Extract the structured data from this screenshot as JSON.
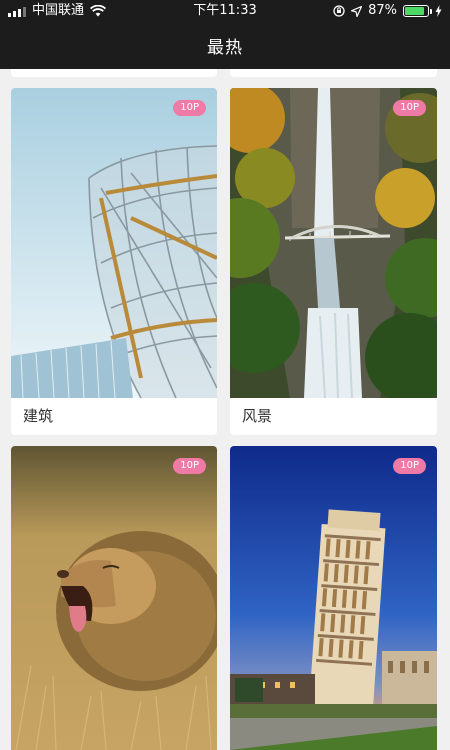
{
  "status_bar": {
    "carrier": "中国联通",
    "time": "下午11:33",
    "battery": "87%",
    "battery_level": 0.87
  },
  "header": {
    "title": "最热"
  },
  "cards": [
    {
      "label": "建筑",
      "badge": "10P",
      "image": "architecture-photo"
    },
    {
      "label": "风景",
      "badge": "10P",
      "image": "waterfall-photo"
    },
    {
      "label": "",
      "badge": "10P",
      "image": "lion-photo"
    },
    {
      "label": "",
      "badge": "10P",
      "image": "leaning-tower-photo"
    }
  ],
  "icons": {
    "signal": "signal-icon",
    "wifi": "wifi-icon",
    "lock_rotation": "rotation-lock-icon",
    "location": "location-icon",
    "battery": "battery-icon",
    "charging": "charging-icon"
  }
}
